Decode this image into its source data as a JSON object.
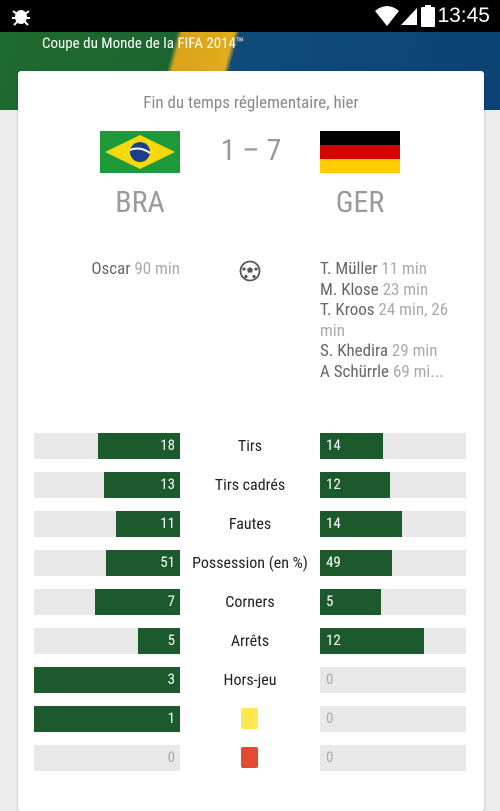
{
  "status_bar": {
    "time": "13:45"
  },
  "banner": {
    "title": "Coupe du Monde de la FIFA 2014™"
  },
  "match": {
    "status": "Fin du temps réglementaire, hier",
    "score": "1 – 7",
    "home": {
      "code": "BRA",
      "flag": "brazil-flag",
      "scorers": [
        {
          "name": "Oscar",
          "minute": "90 min"
        }
      ]
    },
    "away": {
      "code": "GER",
      "flag": "germany-flag",
      "scorers": [
        {
          "name": "T. Müller",
          "minute": "11 min"
        },
        {
          "name": "M. Klose",
          "minute": "23 min"
        },
        {
          "name": "T. Kroos",
          "minute": "24 min, 26 min"
        },
        {
          "name": "S. Khedira",
          "minute": "29 min"
        },
        {
          "name": "A Schürrle",
          "minute": "69 mi..."
        }
      ]
    }
  },
  "stats": [
    {
      "key": "shots",
      "label": "Tirs",
      "home": "18",
      "away": "14",
      "home_fill": 0.56,
      "away_fill": 0.43
    },
    {
      "key": "shots-on-target",
      "label": "Tirs cadrés",
      "home": "13",
      "away": "12",
      "home_fill": 0.52,
      "away_fill": 0.48
    },
    {
      "key": "fouls",
      "label": "Fautes",
      "home": "11",
      "away": "14",
      "home_fill": 0.44,
      "away_fill": 0.56
    },
    {
      "key": "possession",
      "label": "Possession (en %)",
      "home": "51",
      "away": "49",
      "home_fill": 0.51,
      "away_fill": 0.49
    },
    {
      "key": "corners",
      "label": "Corners",
      "home": "7",
      "away": "5",
      "home_fill": 0.58,
      "away_fill": 0.42
    },
    {
      "key": "saves",
      "label": "Arrêts",
      "home": "5",
      "away": "12",
      "home_fill": 0.29,
      "away_fill": 0.71
    },
    {
      "key": "offsides",
      "label": "Hors-jeu",
      "home": "3",
      "away": "0",
      "home_fill": 1.0,
      "away_fill": 0.0
    },
    {
      "key": "yellow-cards",
      "label": "",
      "icon": "yellow-card-icon",
      "icon_color": "#ffe74f",
      "home": "1",
      "away": "0",
      "home_fill": 1.0,
      "away_fill": 0.0
    },
    {
      "key": "red-cards",
      "label": "",
      "icon": "red-card-icon",
      "icon_color": "#e34a32",
      "home": "0",
      "away": "0",
      "home_fill": 0.0,
      "away_fill": 0.0
    }
  ],
  "colors": {
    "bar_fill": "#1c5a2e",
    "bar_track": "#e8e8e8"
  }
}
